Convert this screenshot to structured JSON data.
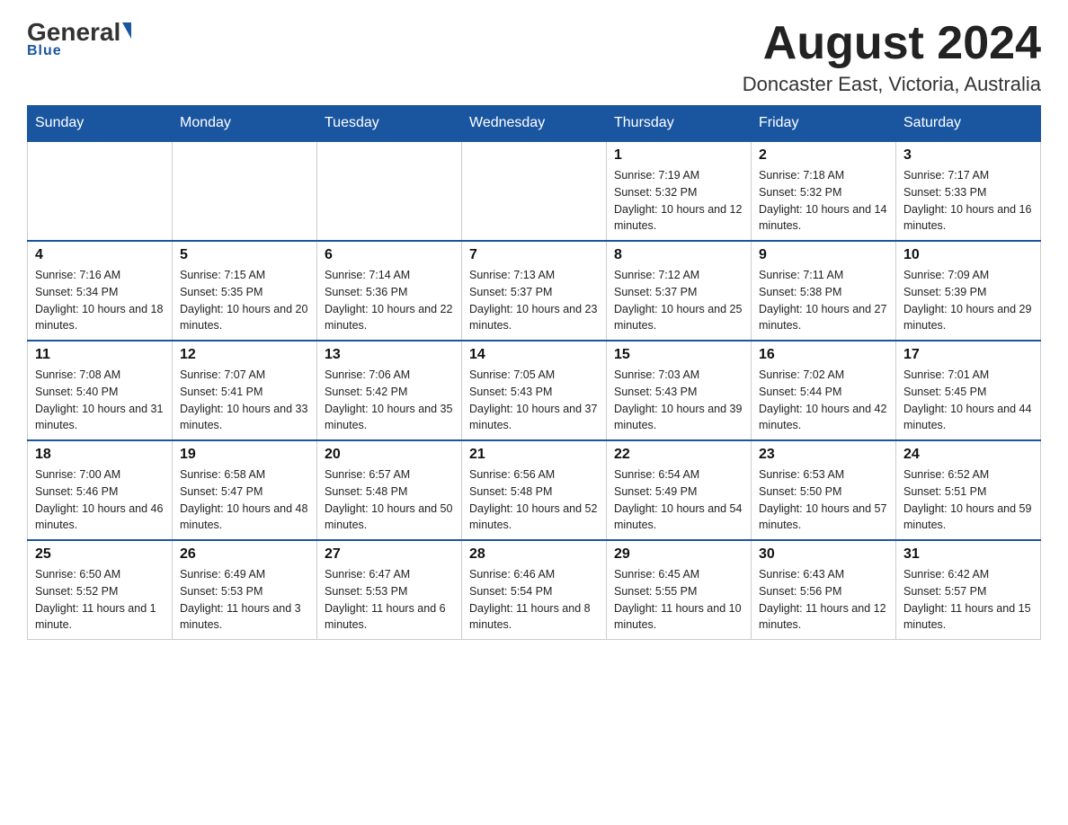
{
  "logo": {
    "general": "General",
    "blue": "Blue"
  },
  "header": {
    "month_year": "August 2024",
    "location": "Doncaster East, Victoria, Australia"
  },
  "days_of_week": [
    "Sunday",
    "Monday",
    "Tuesday",
    "Wednesday",
    "Thursday",
    "Friday",
    "Saturday"
  ],
  "weeks": [
    [
      {
        "day": "",
        "info": ""
      },
      {
        "day": "",
        "info": ""
      },
      {
        "day": "",
        "info": ""
      },
      {
        "day": "",
        "info": ""
      },
      {
        "day": "1",
        "info": "Sunrise: 7:19 AM\nSunset: 5:32 PM\nDaylight: 10 hours and 12 minutes."
      },
      {
        "day": "2",
        "info": "Sunrise: 7:18 AM\nSunset: 5:32 PM\nDaylight: 10 hours and 14 minutes."
      },
      {
        "day": "3",
        "info": "Sunrise: 7:17 AM\nSunset: 5:33 PM\nDaylight: 10 hours and 16 minutes."
      }
    ],
    [
      {
        "day": "4",
        "info": "Sunrise: 7:16 AM\nSunset: 5:34 PM\nDaylight: 10 hours and 18 minutes."
      },
      {
        "day": "5",
        "info": "Sunrise: 7:15 AM\nSunset: 5:35 PM\nDaylight: 10 hours and 20 minutes."
      },
      {
        "day": "6",
        "info": "Sunrise: 7:14 AM\nSunset: 5:36 PM\nDaylight: 10 hours and 22 minutes."
      },
      {
        "day": "7",
        "info": "Sunrise: 7:13 AM\nSunset: 5:37 PM\nDaylight: 10 hours and 23 minutes."
      },
      {
        "day": "8",
        "info": "Sunrise: 7:12 AM\nSunset: 5:37 PM\nDaylight: 10 hours and 25 minutes."
      },
      {
        "day": "9",
        "info": "Sunrise: 7:11 AM\nSunset: 5:38 PM\nDaylight: 10 hours and 27 minutes."
      },
      {
        "day": "10",
        "info": "Sunrise: 7:09 AM\nSunset: 5:39 PM\nDaylight: 10 hours and 29 minutes."
      }
    ],
    [
      {
        "day": "11",
        "info": "Sunrise: 7:08 AM\nSunset: 5:40 PM\nDaylight: 10 hours and 31 minutes."
      },
      {
        "day": "12",
        "info": "Sunrise: 7:07 AM\nSunset: 5:41 PM\nDaylight: 10 hours and 33 minutes."
      },
      {
        "day": "13",
        "info": "Sunrise: 7:06 AM\nSunset: 5:42 PM\nDaylight: 10 hours and 35 minutes."
      },
      {
        "day": "14",
        "info": "Sunrise: 7:05 AM\nSunset: 5:43 PM\nDaylight: 10 hours and 37 minutes."
      },
      {
        "day": "15",
        "info": "Sunrise: 7:03 AM\nSunset: 5:43 PM\nDaylight: 10 hours and 39 minutes."
      },
      {
        "day": "16",
        "info": "Sunrise: 7:02 AM\nSunset: 5:44 PM\nDaylight: 10 hours and 42 minutes."
      },
      {
        "day": "17",
        "info": "Sunrise: 7:01 AM\nSunset: 5:45 PM\nDaylight: 10 hours and 44 minutes."
      }
    ],
    [
      {
        "day": "18",
        "info": "Sunrise: 7:00 AM\nSunset: 5:46 PM\nDaylight: 10 hours and 46 minutes."
      },
      {
        "day": "19",
        "info": "Sunrise: 6:58 AM\nSunset: 5:47 PM\nDaylight: 10 hours and 48 minutes."
      },
      {
        "day": "20",
        "info": "Sunrise: 6:57 AM\nSunset: 5:48 PM\nDaylight: 10 hours and 50 minutes."
      },
      {
        "day": "21",
        "info": "Sunrise: 6:56 AM\nSunset: 5:48 PM\nDaylight: 10 hours and 52 minutes."
      },
      {
        "day": "22",
        "info": "Sunrise: 6:54 AM\nSunset: 5:49 PM\nDaylight: 10 hours and 54 minutes."
      },
      {
        "day": "23",
        "info": "Sunrise: 6:53 AM\nSunset: 5:50 PM\nDaylight: 10 hours and 57 minutes."
      },
      {
        "day": "24",
        "info": "Sunrise: 6:52 AM\nSunset: 5:51 PM\nDaylight: 10 hours and 59 minutes."
      }
    ],
    [
      {
        "day": "25",
        "info": "Sunrise: 6:50 AM\nSunset: 5:52 PM\nDaylight: 11 hours and 1 minute."
      },
      {
        "day": "26",
        "info": "Sunrise: 6:49 AM\nSunset: 5:53 PM\nDaylight: 11 hours and 3 minutes."
      },
      {
        "day": "27",
        "info": "Sunrise: 6:47 AM\nSunset: 5:53 PM\nDaylight: 11 hours and 6 minutes."
      },
      {
        "day": "28",
        "info": "Sunrise: 6:46 AM\nSunset: 5:54 PM\nDaylight: 11 hours and 8 minutes."
      },
      {
        "day": "29",
        "info": "Sunrise: 6:45 AM\nSunset: 5:55 PM\nDaylight: 11 hours and 10 minutes."
      },
      {
        "day": "30",
        "info": "Sunrise: 6:43 AM\nSunset: 5:56 PM\nDaylight: 11 hours and 12 minutes."
      },
      {
        "day": "31",
        "info": "Sunrise: 6:42 AM\nSunset: 5:57 PM\nDaylight: 11 hours and 15 minutes."
      }
    ]
  ]
}
